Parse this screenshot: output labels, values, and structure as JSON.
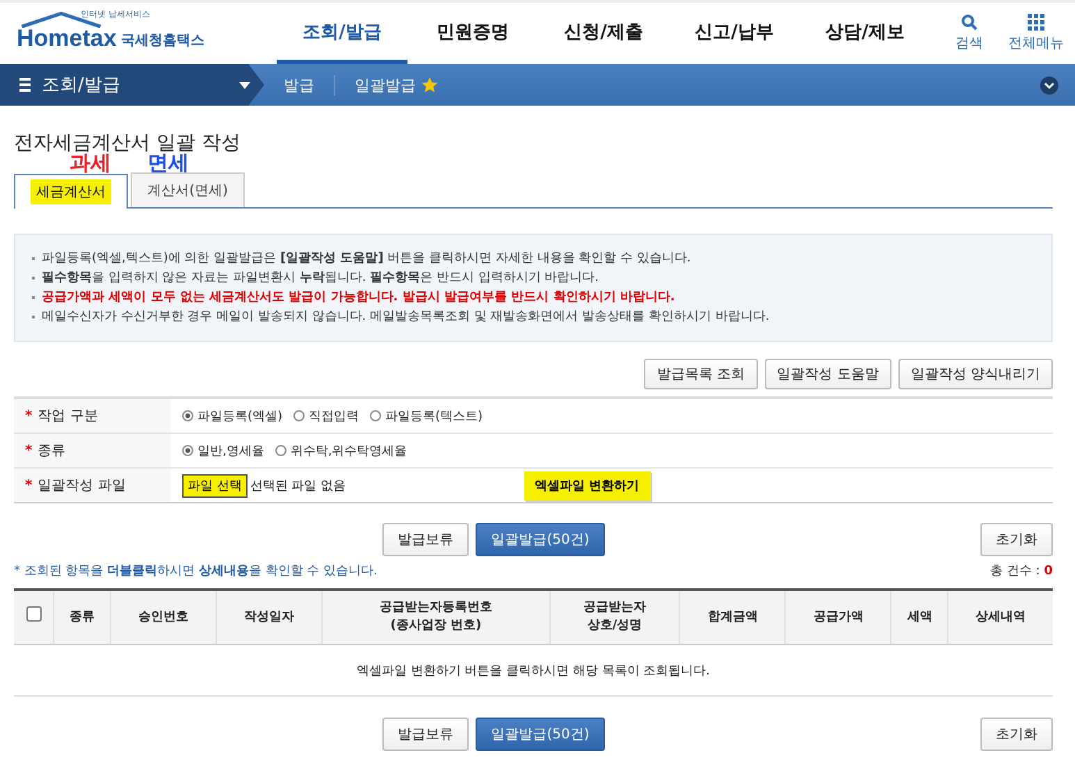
{
  "header": {
    "logo_small": "인터넷 납세서비스",
    "logo": "Hometax",
    "logo_sub": "국세청홈택스",
    "menu": [
      {
        "label": "조회/발급",
        "selected": true
      },
      {
        "label": "민원증명",
        "selected": false
      },
      {
        "label": "신청/제출",
        "selected": false
      },
      {
        "label": "신고/납부",
        "selected": false
      },
      {
        "label": "상담/제보",
        "selected": false
      }
    ],
    "search": "검색",
    "all_menu": "전체메뉴"
  },
  "nav": {
    "section": "조회/발급",
    "crumbs": [
      "발급",
      "일괄발급"
    ]
  },
  "title": "전자세금계산서 일괄 작성",
  "annotations": [
    {
      "text": "과세",
      "color": "#e8202a"
    },
    {
      "text": "면세",
      "color": "#1d4fe0"
    }
  ],
  "tabs": [
    {
      "label": "세금계산서",
      "selected": true,
      "highlighted": true
    },
    {
      "label": "계산서(면세)",
      "selected": false,
      "highlighted": false
    }
  ],
  "notices": [
    {
      "text": "파일등록(엑셀,텍스트)에 의한 일괄발급은 **[일괄작성 도움말]** 버튼을 클릭하시면 자세한 내용을 확인할 수 있습니다.",
      "warning": false
    },
    {
      "text": "**필수항목**을 입력하지 않은 자료는 파일변환시 **누락**됩니다. **필수항목**은 반드시 입력하시기 바랍니다.",
      "warning": false
    },
    {
      "text": "공급가액과 세액이 모두 없는 세금계산서도 발급이 가능합니다. 발급시 발급여부를 반드시 확인하시기 바랍니다.",
      "warning": true
    },
    {
      "text": "메일수신자가 수신거부한 경우 메일이 발송되지 않습니다. 메일발송목록조회 및 재발송화면에서 발송상태를 확인하시기 바랍니다.",
      "warning": false
    }
  ],
  "top_buttons": [
    "발급목록 조회",
    "일괄작성 도움말",
    "일괄작성 양식내리기"
  ],
  "form": [
    {
      "required_mark": "*",
      "label": "작업 구분",
      "kind": "radio",
      "options": [
        {
          "label": "파일등록(엑셀)",
          "selected": true
        },
        {
          "label": "직접입력",
          "selected": false
        },
        {
          "label": "파일등록(텍스트)",
          "selected": false
        }
      ]
    },
    {
      "required_mark": "*",
      "label": "종류",
      "kind": "radio",
      "options": [
        {
          "label": "일반,영세율",
          "selected": true
        },
        {
          "label": "위수탁,위수탁영세율",
          "selected": false
        }
      ]
    },
    {
      "required_mark": "*",
      "label": "일괄작성 파일",
      "kind": "file",
      "file_button": "파일 선택",
      "file_status": "선택된 파일 없음",
      "convert_button": "엑셀파일 변환하기"
    }
  ],
  "actions": {
    "hold": "발급보류",
    "issue": "일괄발급(50건)",
    "reset": "초기화"
  },
  "hint": "* 조회된 항목을 **더블클릭**하시면 **상세내용**을 확인할 수 있습니다.",
  "count_label": "총 건수 :",
  "count": "0",
  "table": {
    "select_all_checked": false,
    "columns": [
      {
        "lines": [
          "종류"
        ]
      },
      {
        "lines": [
          "승인번호"
        ]
      },
      {
        "lines": [
          "작성일자"
        ]
      },
      {
        "lines": [
          "공급받는자등록번호",
          "(종사업장 번호)"
        ]
      },
      {
        "lines": [
          "공급받는자",
          "상호/성명"
        ]
      },
      {
        "lines": [
          "합계금액"
        ]
      },
      {
        "lines": [
          "공급가액"
        ]
      },
      {
        "lines": [
          "세액"
        ]
      },
      {
        "lines": [
          "상세내역"
        ]
      }
    ],
    "empty": "엑셀파일 변환하기 버튼을 클릭하시면 해당 목록이 조회됩니다."
  },
  "bottom_actions": {
    "hold": "발급보류",
    "issue": "일괄발급(50건)",
    "reset": "초기화"
  }
}
